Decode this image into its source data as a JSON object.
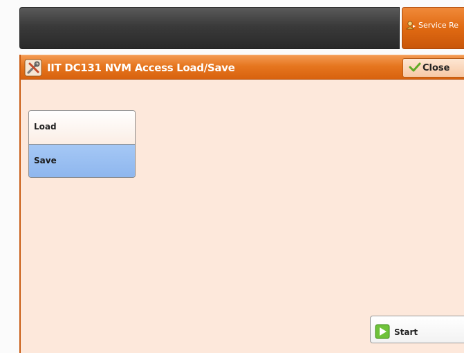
{
  "service_tab": {
    "label": "Service Re",
    "icon": "service-rep-icon"
  },
  "window": {
    "title": "IIT DC131 NVM Access Load/Save",
    "title_icon": "tools-icon",
    "close_label": "Close",
    "close_icon": "checkmark-icon"
  },
  "choices": [
    {
      "label": "Load",
      "selected": false
    },
    {
      "label": "Save",
      "selected": true
    }
  ],
  "start": {
    "label": "Start",
    "icon": "start-play-icon"
  },
  "colors": {
    "accent_orange": "#e6761f",
    "selected_blue": "#9cc0f2",
    "panel_bg": "#fde8db",
    "start_green": "#6fc23a"
  }
}
